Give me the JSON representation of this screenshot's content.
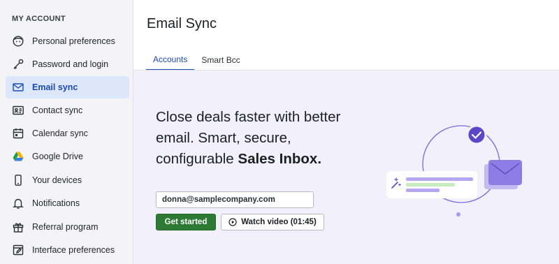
{
  "sidebar": {
    "heading": "MY ACCOUNT",
    "items": [
      {
        "label": "Personal preferences",
        "icon": "face-icon"
      },
      {
        "label": "Password and login",
        "icon": "key-icon"
      },
      {
        "label": "Email sync",
        "icon": "envelope-icon",
        "active": true
      },
      {
        "label": "Contact sync",
        "icon": "contact-card-icon"
      },
      {
        "label": "Calendar sync",
        "icon": "calendar-icon"
      },
      {
        "label": "Google Drive",
        "icon": "google-drive-icon"
      },
      {
        "label": "Your devices",
        "icon": "phone-icon"
      },
      {
        "label": "Notifications",
        "icon": "bell-icon"
      },
      {
        "label": "Referral program",
        "icon": "gift-icon"
      },
      {
        "label": "Interface preferences",
        "icon": "edit-window-icon"
      }
    ]
  },
  "main": {
    "title": "Email Sync",
    "tabs": [
      {
        "label": "Accounts",
        "active": true
      },
      {
        "label": "Smart Bcc",
        "active": false
      }
    ],
    "hero": {
      "headline_line1": "Close deals faster with better",
      "headline_line2": "email. Smart, secure,",
      "headline_line3_plain": "configurable ",
      "headline_line3_bold": "Sales Inbox.",
      "email_value": "donna@samplecompany.com",
      "get_started_label": "Get started",
      "watch_video_label": "Watch video (01:45)"
    }
  },
  "colors": {
    "accent_blue": "#1a49b8",
    "active_bg": "#dce7fb",
    "primary_green": "#2c7a34",
    "hero_bg": "#f1f0fb",
    "illustration_purple": "#6f5bd9"
  }
}
